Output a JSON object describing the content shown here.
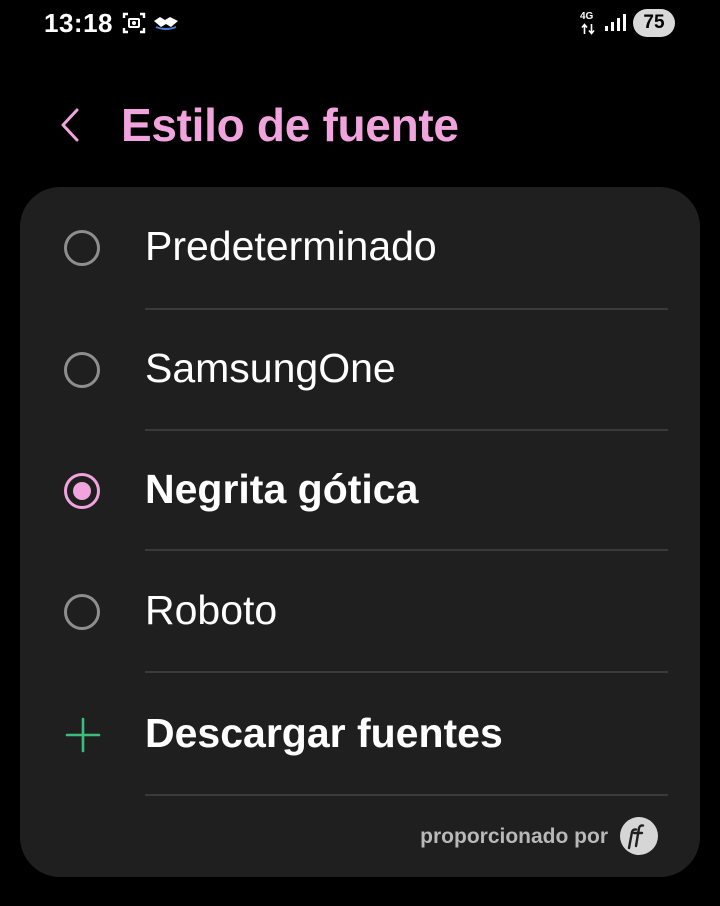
{
  "status_bar": {
    "time": "13:18",
    "network": "4G",
    "battery": "75"
  },
  "header": {
    "title": "Estilo de fuente"
  },
  "options": [
    {
      "label": "Predeterminado",
      "selected": false
    },
    {
      "label": "SamsungOne",
      "selected": false
    },
    {
      "label": "Negrita gótica",
      "selected": true
    },
    {
      "label": "Roboto",
      "selected": false
    }
  ],
  "download": {
    "label": "Descargar fuentes"
  },
  "footer": {
    "provided_by": "proporcionado por"
  },
  "colors": {
    "accent": "#f0a3dc",
    "card": "#1f1f1f",
    "plus": "#3dbd7d"
  }
}
